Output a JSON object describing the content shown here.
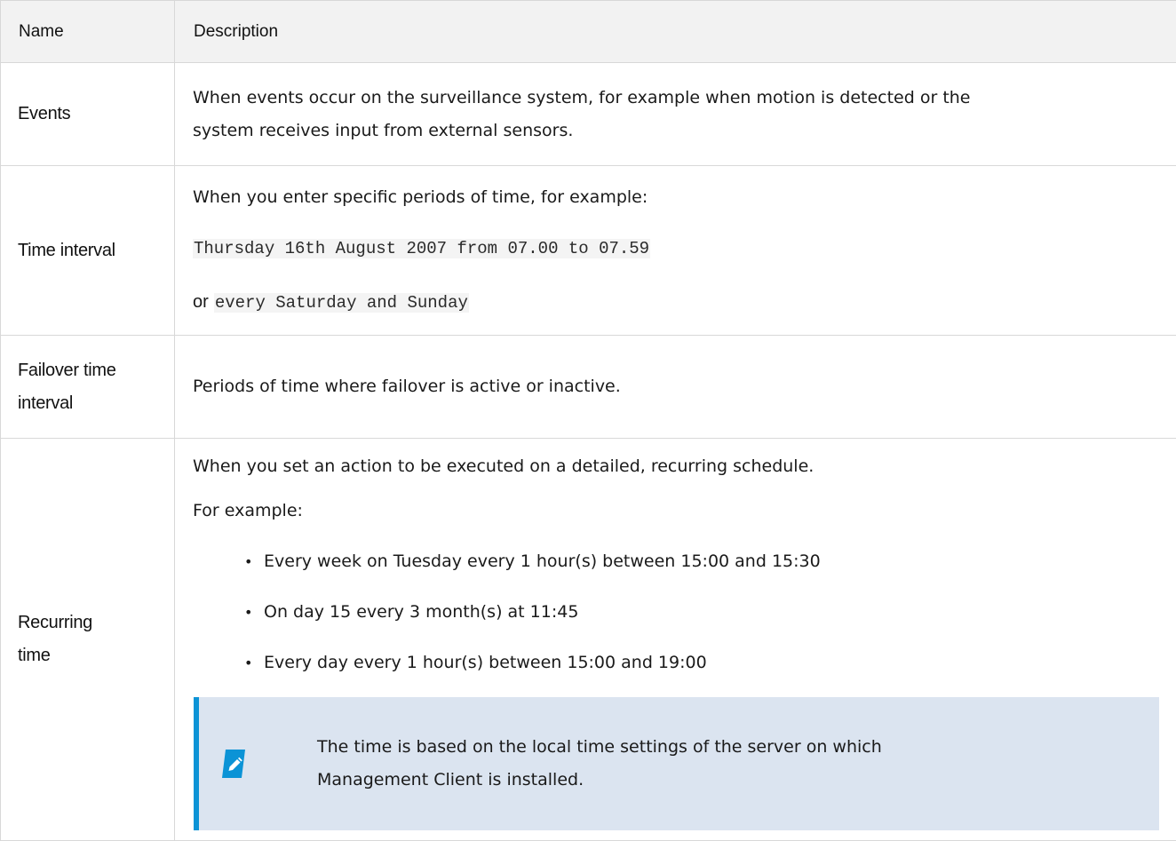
{
  "header": {
    "name": "Name",
    "description": "Description"
  },
  "rows": {
    "events": {
      "name": "Events",
      "line1": "When events occur on the surveillance system, for example when motion is detected or the",
      "line2": "system receives input from external sensors."
    },
    "time_interval": {
      "name": "Time interval",
      "line1": "When you enter specific periods of time, for example:",
      "code1": "Thursday 16th August 2007 from 07.00 to 07.59",
      "or": "or",
      "code2": "every Saturday and Sunday"
    },
    "failover": {
      "name_line1": "Failover time",
      "name_line2": "interval",
      "text": "Periods of time where failover is active or inactive."
    },
    "recurring": {
      "name_line1": "Recurring",
      "name_line2": "time",
      "line1": "When you set an action to be executed on a detailed, recurring schedule.",
      "line2": "For example:",
      "items": [
        "Every week on Tuesday every 1 hour(s) between 15:00 and 15:30",
        "On day 15 every 3 month(s) at 11:45",
        "Every day every 1 hour(s) between 15:00 and 19:00"
      ],
      "note_line1": "The time is based on the local time settings of the server on which",
      "note_line2": "Management Client is installed."
    }
  },
  "colors": {
    "accent": "#0b93d6",
    "note_bg": "#dbe4f0",
    "header_bg": "#f2f2f2"
  },
  "icons": {
    "note": "pencil-icon"
  }
}
